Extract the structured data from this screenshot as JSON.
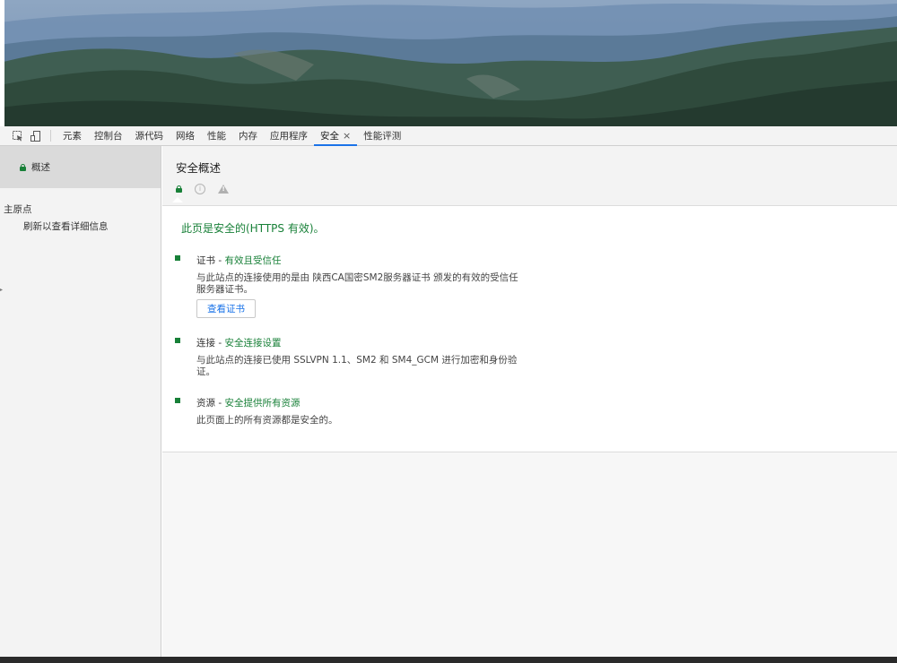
{
  "devtools": {
    "tabs": [
      {
        "label": "元素",
        "active": false
      },
      {
        "label": "控制台",
        "active": false
      },
      {
        "label": "源代码",
        "active": false
      },
      {
        "label": "网络",
        "active": false
      },
      {
        "label": "性能",
        "active": false
      },
      {
        "label": "内存",
        "active": false
      },
      {
        "label": "应用程序",
        "active": false
      },
      {
        "label": "安全",
        "active": true,
        "closable": true
      },
      {
        "label": "性能评测",
        "active": false
      }
    ],
    "icons": [
      "inspect-element-icon",
      "device-toolbar-icon"
    ]
  },
  "sidebar": {
    "overview_label": "概述",
    "group_label": "主原点",
    "item_label": "刷新以查看详细信息"
  },
  "main": {
    "title": "安全概述",
    "summary": "此页是安全的(HTTPS 有效)。",
    "sections": [
      {
        "head": "证书 - ",
        "status": "有效且受信任",
        "description": "与此站点的连接使用的是由 陕西CA国密SM2服务器证书 颁发的有效的受信任服务器证书。",
        "button": "查看证书"
      },
      {
        "head": "连接 - ",
        "status": "安全连接设置",
        "description": "与此站点的连接已使用 SSLVPN 1.1、SM2 和 SM4_GCM 进行加密和身份验证。"
      },
      {
        "head": "资源 - ",
        "status": "安全提供所有资源",
        "description": "此页面上的所有资源都是安全的。"
      }
    ]
  },
  "colors": {
    "secure_green": "#188038",
    "accent_blue": "#1a73e8",
    "panel_bg": "#f3f3f3"
  }
}
